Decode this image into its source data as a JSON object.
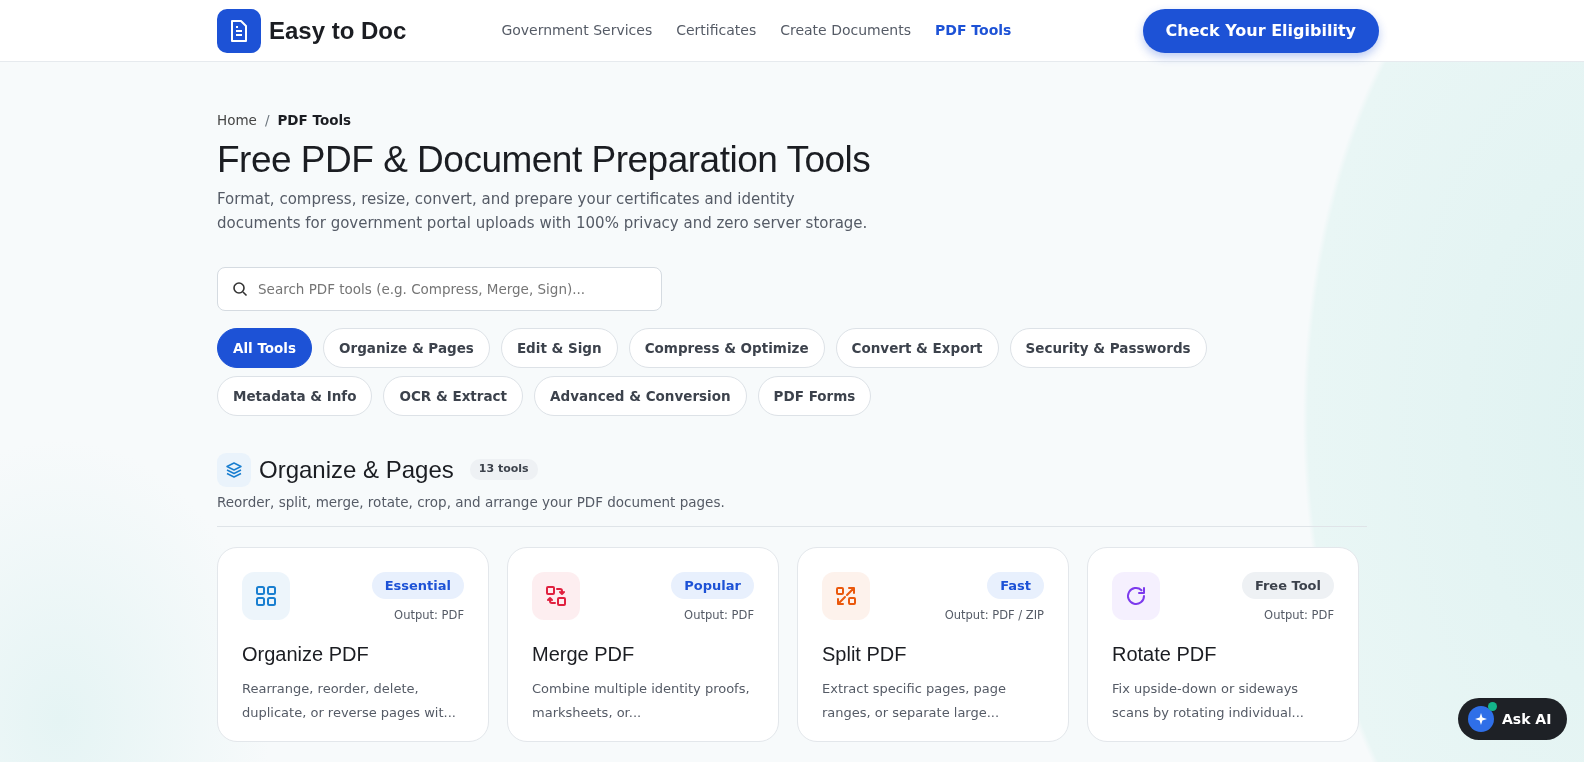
{
  "header": {
    "brand": "Easy to Doc",
    "nav": [
      {
        "label": "Government Services",
        "selected": false
      },
      {
        "label": "Certificates",
        "selected": false
      },
      {
        "label": "Create Documents",
        "selected": false
      },
      {
        "label": "PDF Tools",
        "selected": true
      }
    ],
    "cta": "Check Your Eligibility"
  },
  "breadcrumb_separator": "/",
  "breadcrumb": [
    {
      "label": "Home",
      "current": false
    },
    {
      "label": "PDF Tools",
      "current": true
    }
  ],
  "title": "Free PDF & Document Preparation Tools",
  "subtitle": "Format, compress, resize, convert, and prepare your certificates and identity documents for government portal uploads with 100% privacy and zero server storage.",
  "search": {
    "placeholder": "Search PDF tools (e.g. Compress, Merge, Sign)..."
  },
  "filters": [
    {
      "label": "All Tools",
      "selected": true
    },
    {
      "label": "Organize & Pages",
      "selected": false
    },
    {
      "label": "Edit & Sign",
      "selected": false
    },
    {
      "label": "Compress & Optimize",
      "selected": false
    },
    {
      "label": "Convert & Export",
      "selected": false
    },
    {
      "label": "Security & Passwords",
      "selected": false
    },
    {
      "label": "Metadata & Info",
      "selected": false
    },
    {
      "label": "OCR & Extract",
      "selected": false
    },
    {
      "label": "Advanced & Conversion",
      "selected": false
    },
    {
      "label": "PDF Forms",
      "selected": false
    }
  ],
  "section": {
    "title": "Organize & Pages",
    "count": "13 tools",
    "description": "Reorder, split, merge, rotate, crop, and arrange your PDF document pages."
  },
  "tools": [
    {
      "kind": "grid",
      "color": "#1a7fd0",
      "badge": "Essential",
      "badge_muted": false,
      "output": "Output: PDF",
      "name": "Organize PDF",
      "description": "Rearrange, reorder, delete, duplicate, or reverse pages wit..."
    },
    {
      "kind": "merge",
      "color": "#e0213f",
      "badge": "Popular",
      "badge_muted": false,
      "output": "Output: PDF",
      "name": "Merge PDF",
      "description": "Combine multiple identity proofs, marksheets, or..."
    },
    {
      "kind": "split",
      "color": "#ea580c",
      "badge": "Fast",
      "badge_muted": false,
      "output": "Output: PDF / ZIP",
      "name": "Split PDF",
      "description": "Extract specific pages, page ranges, or separate large..."
    },
    {
      "kind": "rotate",
      "color": "#7c3aed",
      "badge": "Free Tool",
      "badge_muted": true,
      "output": "Output: PDF",
      "name": "Rotate PDF",
      "description": "Fix upside-down or sideways scans by rotating individual..."
    }
  ],
  "assistant": {
    "label": "Ask AI",
    "online": true
  }
}
